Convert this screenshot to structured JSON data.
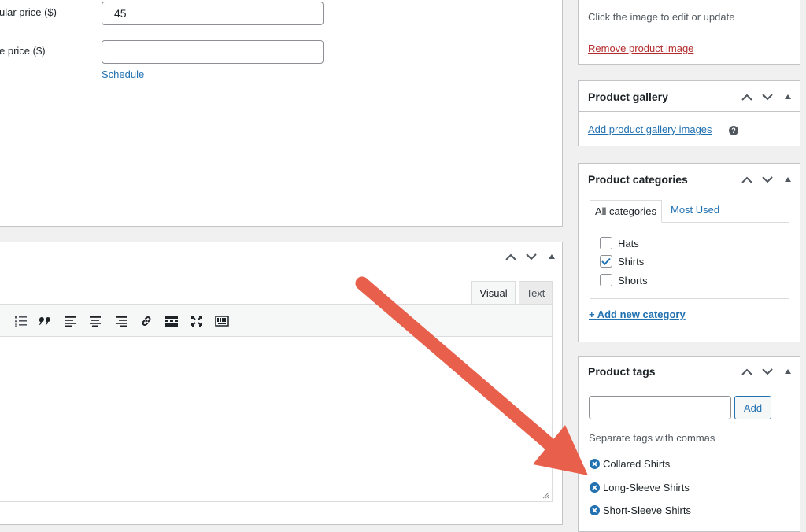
{
  "pricing": {
    "regular_label": "ular price ($)",
    "regular_value": "45",
    "sale_label": "e price ($)",
    "sale_value": "",
    "schedule_link": "Schedule"
  },
  "editor": {
    "tabs": [
      {
        "label": "Visual",
        "active": true
      },
      {
        "label": "Text",
        "active": false
      }
    ],
    "toolbar_icons": [
      "numbered-list-icon",
      "blockquote-icon",
      "align-left-icon",
      "align-center-icon",
      "align-right-icon",
      "insert-link-icon",
      "read-more-icon",
      "fullscreen-icon",
      "toolbar-toggle-icon"
    ]
  },
  "product_image": {
    "hint": "Click the image to edit or update",
    "remove_link": "Remove product image"
  },
  "gallery": {
    "title": "Product gallery",
    "add_link": "Add product gallery images",
    "help": "?"
  },
  "categories": {
    "title": "Product categories",
    "tabs": [
      "All categories",
      "Most Used"
    ],
    "items": [
      {
        "label": "Hats",
        "checked": false
      },
      {
        "label": "Shirts",
        "checked": true
      },
      {
        "label": "Shorts",
        "checked": false
      }
    ],
    "add_link": "+ Add new category"
  },
  "tags": {
    "title": "Product tags",
    "input_value": "",
    "add_button": "Add",
    "hint": "Separate tags with commas",
    "items": [
      "Collared Shirts",
      "Long-Sleeve Shirts",
      "Short-Sleeve Shirts"
    ]
  },
  "colors": {
    "link": "#2271b1",
    "remove_link": "#b32d2e",
    "annotation_arrow": "#e8604c",
    "checkmark": "#2271b1"
  }
}
